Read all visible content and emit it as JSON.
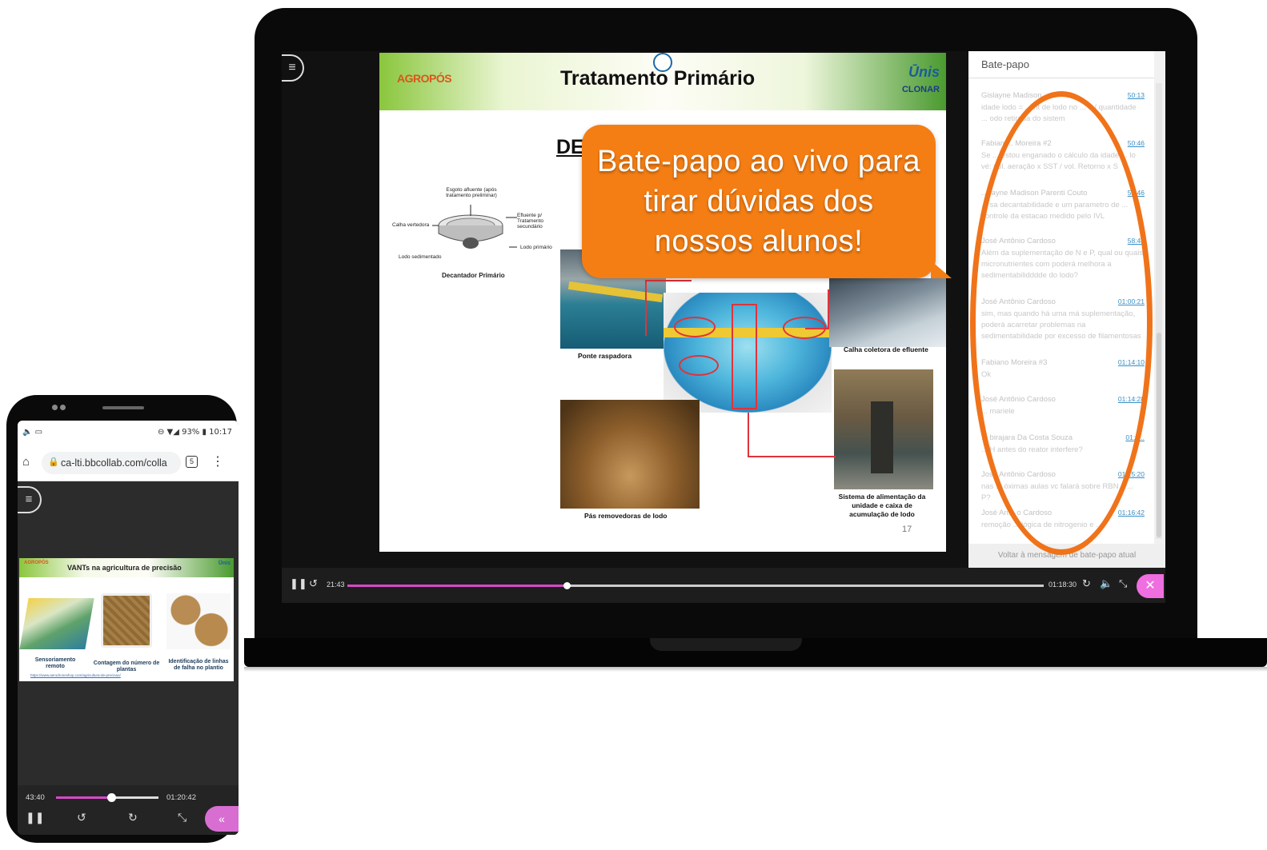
{
  "laptop": {
    "slide": {
      "logo_left": "AGROPÓS",
      "title": "Tratamento Primário",
      "logo_right_1": "Ūnis",
      "logo_right_2": "CLONAR",
      "heading_fragment": "DE",
      "diagram_labels": {
        "top": "Esgoto afluente (após tratamento preliminar)",
        "right_top": "Efluente p/ Tratamento secundário",
        "left": "Calha vertedora",
        "right_bottom": "Lodo primário",
        "bottom_left": "Lodo sedimentado",
        "caption": "Decantador Primário"
      },
      "photo_captions": {
        "ponte": "Ponte raspadora",
        "calha": "Calha coletora de efluente",
        "pas": "Pás removedoras de lodo",
        "sistema": "Sistema de alimentação da unidade e caixa de acumulação de lodo"
      },
      "page_number": "17"
    },
    "callout": "Bate-papo ao vivo para tirar dúvidas dos nossos alunos!",
    "chat": {
      "title": "Bate-papo",
      "messages": [
        {
          "name": "Gislayne Madison",
          "time": "50:13",
          "text": "idade lodo = ... nt de lodo no ... e / quantidade ... odo retirada do sistem"
        },
        {
          "name": "Fabian ... Moreira #2",
          "time": "50:46",
          "text": "Se ... estou enganado o cálculo da idade ... lo vé: vol. aeração x SST / vol. Retorno x S"
        },
        {
          "name": "... layne Madison Parenti Couto",
          "time": "51:46",
          "text": "... sa decantabilidade e um parametro de ... controle da estacao medido pelo IVL"
        },
        {
          "name": "José Antônio Cardoso",
          "time": "58:48",
          "text": "Além da suplementação de N e P, qual ou quais micronutrientes com poderá melhora a sedimentabilidddde do lodo?"
        },
        {
          "name": "José Antônio Cardoso",
          "time": "01:00:21",
          "text": "sim, mas quando há uma má suplementação, poderá acarretar problemas na sedimentabilidade por excesso de filamentosas"
        },
        {
          "name": "Fabiano Moreira #3",
          "time": "01:14:10",
          "text": "Ok"
        },
        {
          "name": "José Antônio Cardoso",
          "time": "01:14:28",
          "text": "... mariele"
        },
        {
          "name": "... birajara Da Costa Souza",
          "time": "01:1...",
          "text": "... H antes do reator interfere?"
        },
        {
          "name": "José Antônio Cardoso",
          "time": "01:15:20",
          "text": "nas ... óximas aulas vc falará sobre RBN e ... P?"
        },
        {
          "name": "José An... o Cardoso",
          "time": "01:16:42",
          "text": "remoção ... lógica de nitrogenio e ..."
        }
      ],
      "footer": "Voltar à mensagem de bate-papo atual"
    },
    "player": {
      "elapsed": "21:43",
      "total": "01:18:30",
      "progress": 0.316
    }
  },
  "phone": {
    "status": {
      "left": "🔈 ▭",
      "right": "⊖ ▼◢ 93% ▮ 10:17"
    },
    "browser": {
      "url": "ca-lti.bbcollab.com/colla",
      "tab_count": "5"
    },
    "slide": {
      "title": "VANTs na agricultura de precisão",
      "logo_left": "AGROPÓS",
      "logo_right": "Ūnis",
      "captions": [
        "Sensoriamento remoto",
        "Contagem do número de plantas",
        "Identificação de linhas de falha no plantio"
      ],
      "link": "https://www.aerodroneshop.com/agricultura-de-precisao/"
    },
    "player": {
      "elapsed": "43:40",
      "total": "01:20:42",
      "progress": 0.541
    }
  }
}
